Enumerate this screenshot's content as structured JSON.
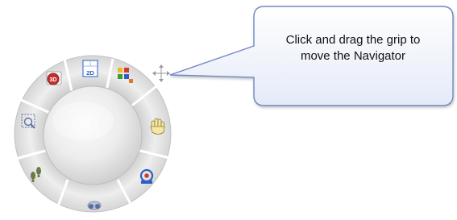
{
  "callout": {
    "line1": "Click and drag the grip to",
    "line2": "move the Navigator"
  },
  "navigator": {
    "wedges": [
      {
        "name": "orbit-3d-wedge",
        "icon": "orbit-3d-icon",
        "icon_label": "3D"
      },
      {
        "name": "view-2d-wedge",
        "icon": "view-2d-icon",
        "icon_label": "2D"
      },
      {
        "name": "view-layout-wedge",
        "icon": "layout-grid-icon"
      },
      {
        "name": "pan-wedge",
        "icon": "hand-icon"
      },
      {
        "name": "look-wedge",
        "icon": "look-around-icon"
      },
      {
        "name": "fly-wedge",
        "icon": "binoculars-icon"
      },
      {
        "name": "walk-wedge",
        "icon": "footprints-icon"
      },
      {
        "name": "zoom-wedge",
        "icon": "zoom-window-icon"
      }
    ]
  },
  "colors": {
    "callout_border": "#6f88c6",
    "callout_fill_top": "#ffffff",
    "callout_fill_bottom": "#e7ecf9",
    "ring_light": "#ececec",
    "ring_dark": "#d3d3d3",
    "separator": "#ffffff",
    "red": "#c63030",
    "blue": "#2f5fc4"
  }
}
